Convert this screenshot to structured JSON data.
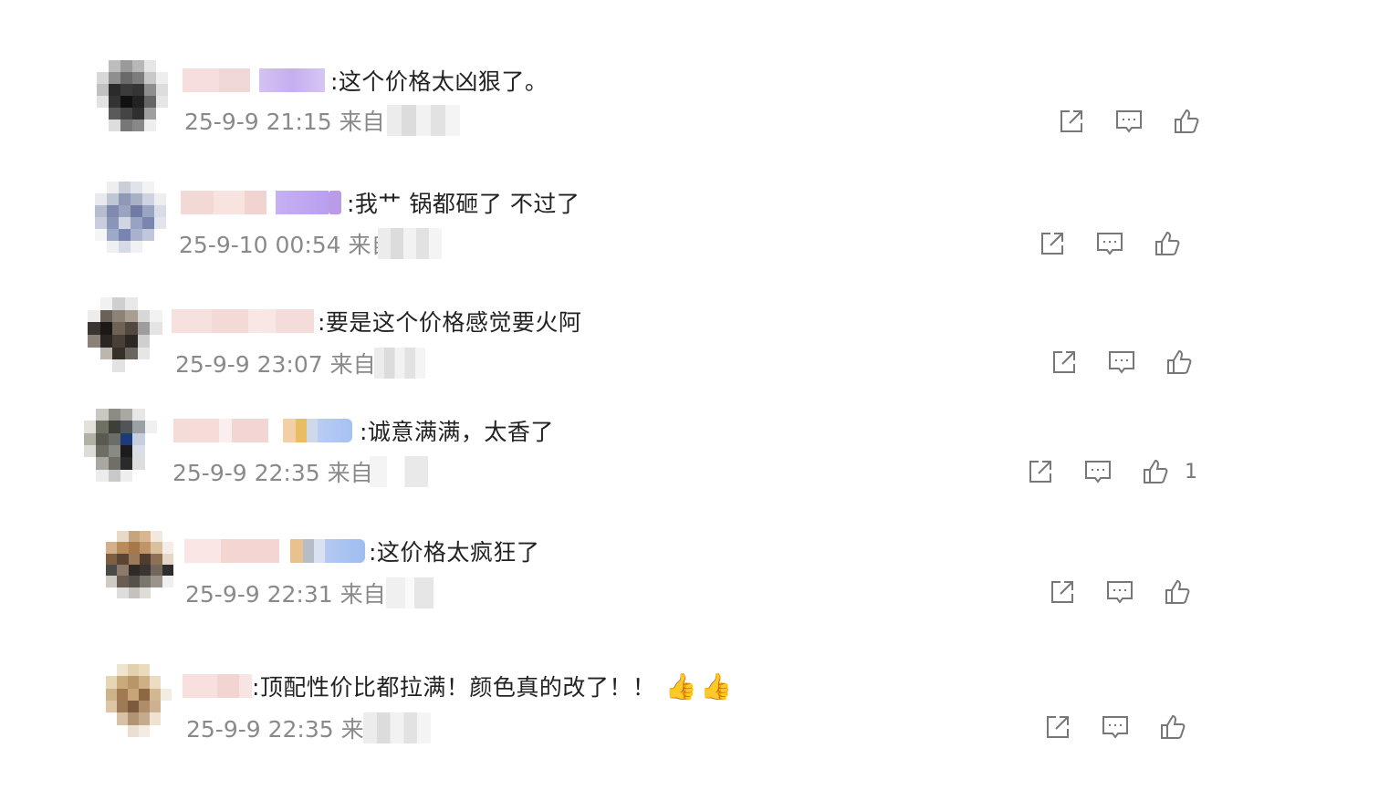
{
  "comments": [
    {
      "text": ":这个价格太凶狠了。",
      "meta": "25-9-9 21:15 来自",
      "likes": ""
    },
    {
      "text": ":我艹  锅都砸了 不过了",
      "meta": "25-9-10 00:54 来自",
      "likes": ""
    },
    {
      "text": ":要是这个价格感觉要火阿",
      "meta": "25-9-9 23:07 来自",
      "likes": ""
    },
    {
      "text": ":诚意满满，太香了",
      "meta": "25-9-9 22:35 来自",
      "likes": "1"
    },
    {
      "text": ":这价格太疯狂了",
      "meta": "25-9-9 22:31 来自",
      "likes": ""
    },
    {
      "text": ":顶配性价比都拉满！颜色真的改了！！",
      "meta": "25-9-9 22:35 来自",
      "likes": ""
    }
  ],
  "icons": {
    "share": "share-icon",
    "reply": "comment-icon",
    "like": "thumbs-up-icon",
    "emoji": "👍"
  },
  "colors": {
    "text": "#222222",
    "meta": "#8a8a8a",
    "icon": "#777777"
  }
}
